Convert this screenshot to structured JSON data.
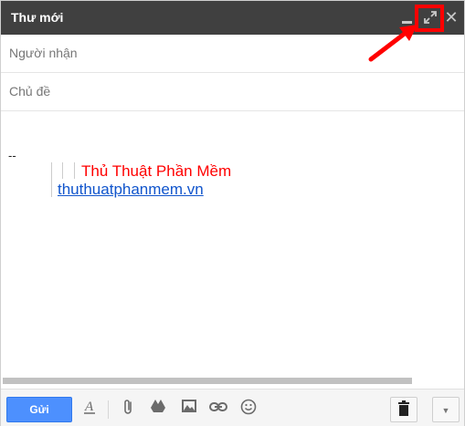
{
  "window": {
    "title": "Thư mới"
  },
  "fields": {
    "to_placeholder": "Người nhận",
    "subject_placeholder": "Chủ đề"
  },
  "signature": {
    "dashes": "--",
    "name": "Thủ Thuật Phần Mềm",
    "link": "thuthuatphanmem.vn"
  },
  "toolbar": {
    "send_label": "Gửi"
  },
  "icons": {
    "minimize": "minimize-icon",
    "maximize": "maximize-icon",
    "close": "close-icon",
    "formatting": "text-format-icon",
    "attach": "paperclip-icon",
    "drive": "drive-icon",
    "photo": "photo-icon",
    "link": "link-icon",
    "emoji": "emoji-icon",
    "trash": "trash-icon",
    "more": "chevron-down-icon"
  },
  "colors": {
    "titlebar": "#404040",
    "send_button": "#4d90fe",
    "annotation": "#ff0000",
    "signature_name": "#ff0000",
    "link": "#1155cc"
  }
}
